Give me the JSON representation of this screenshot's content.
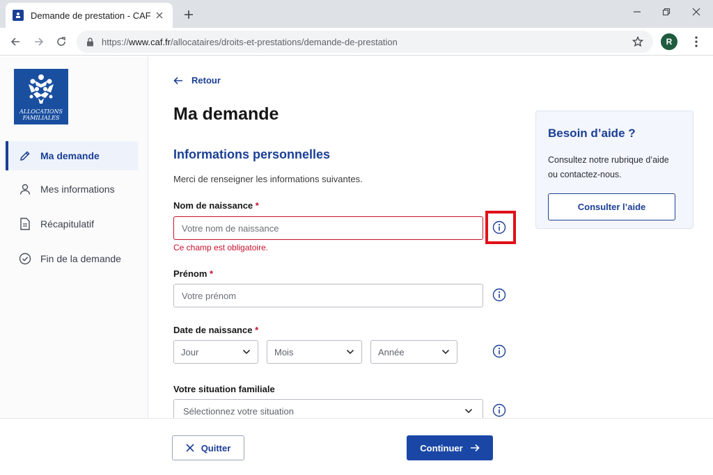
{
  "browser": {
    "tab_title": "Demande de prestation - CAF",
    "url_prefix": "https://",
    "url_domain": "www.caf.fr",
    "url_path": "/allocataires/droits-et-prestations/demande-de-prestation",
    "profile_initial": "R"
  },
  "logo": {
    "line1": "ALLOCATIONS",
    "line2": "FAMILIALES"
  },
  "sidebar": {
    "items": [
      {
        "label": "Ma demande",
        "icon": "pencil-icon",
        "active": true
      },
      {
        "label": "Mes informations",
        "icon": "user-icon",
        "active": false
      },
      {
        "label": "Récapitulatif",
        "icon": "document-icon",
        "active": false
      },
      {
        "label": "Fin de la demande",
        "icon": "check-circle-icon",
        "active": false
      }
    ]
  },
  "main": {
    "back_label": "Retour",
    "title": "Ma demande",
    "section_title": "Informations personnelles",
    "intro": "Merci de renseigner les informations suivantes.",
    "required_mark": "*",
    "fields": {
      "birth_name": {
        "label": "Nom de naissance",
        "placeholder": "Votre nom de naissance",
        "error": "Ce champ est obligatoire."
      },
      "first_name": {
        "label": "Prénom",
        "placeholder": "Votre prénom"
      },
      "birth_date": {
        "label": "Date de naissance",
        "day": "Jour",
        "month": "Mois",
        "year": "Année"
      },
      "family_status": {
        "label": "Votre situation familiale",
        "placeholder": "Sélectionnez votre situation"
      }
    }
  },
  "help": {
    "title": "Besoin d’aide ?",
    "text": "Consultez notre rubrique d’aide ou contactez-nous.",
    "button": "Consulter l’aide"
  },
  "footer": {
    "quit": "Quitter",
    "continue": "Continuer"
  },
  "colors": {
    "brand": "#1a3f95",
    "error": "#c8102e",
    "highlight": "#e0101a"
  }
}
